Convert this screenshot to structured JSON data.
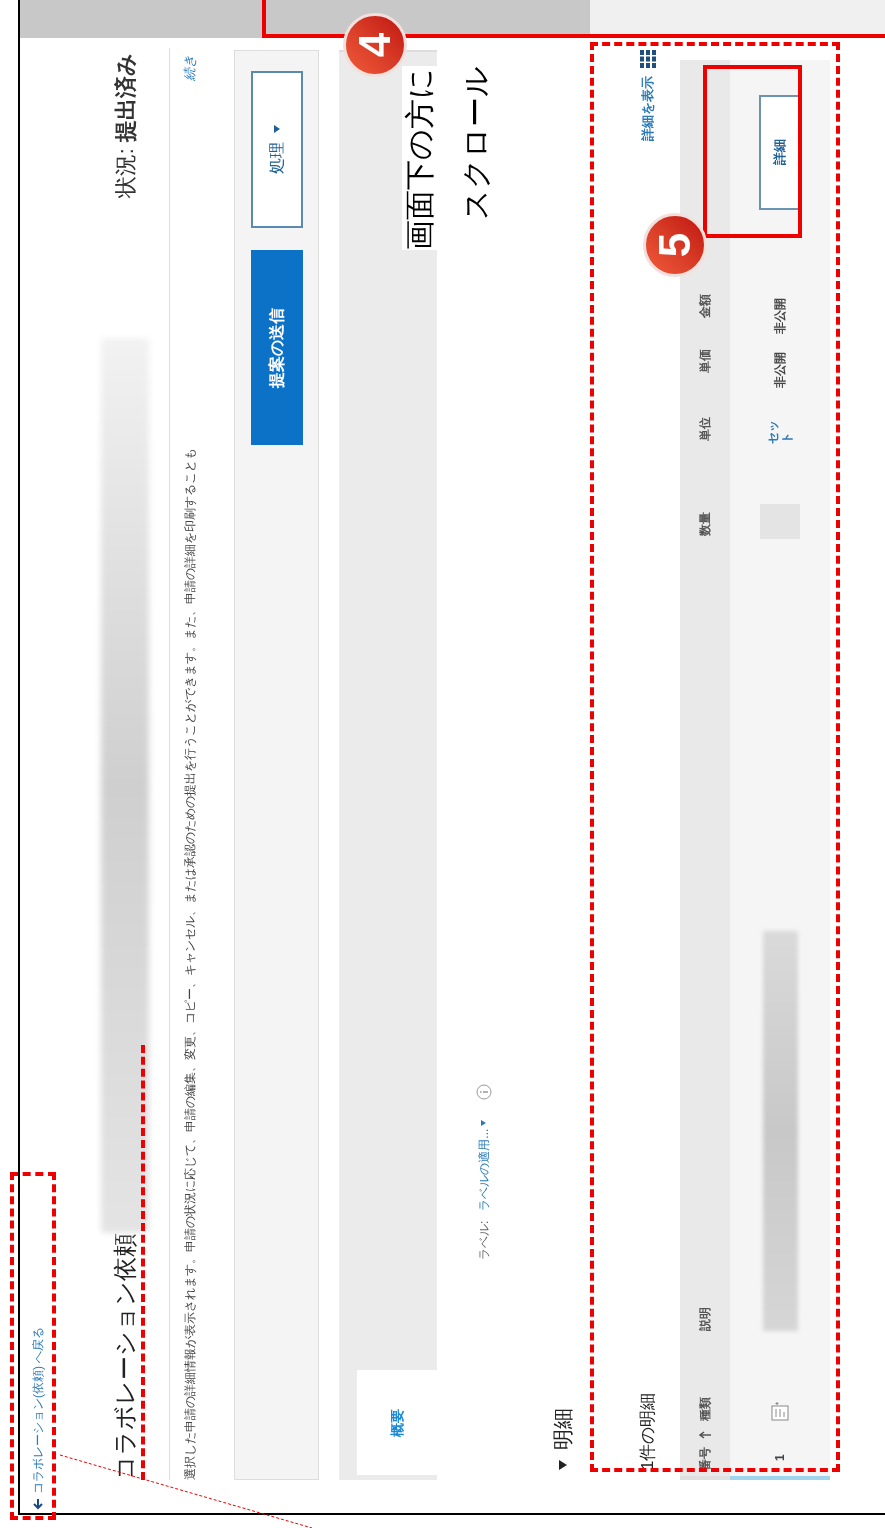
{
  "breadcrumb": {
    "text": "コラボレーション(依頼) へ戻る"
  },
  "title": "コラボレーション依頼",
  "status": {
    "label": "状況:",
    "value": "提出済み"
  },
  "description": "選択した申請の詳細情報が表示されます。申請の状況に応じて、申請の編集、変更、コピー、キャンセル、または承認のための提出を行うことができます。また、申請の詳細を印刷することも",
  "more_link": "続き",
  "toolbar": {
    "buttons": [
      {
        "label": "提案の送信",
        "kind": "primary"
      },
      {
        "label": "処理",
        "kind": "menu"
      }
    ]
  },
  "tabs": [
    {
      "label": "概要",
      "selected": true
    }
  ],
  "labels": {
    "label": "ラベル:",
    "link": "ラベルの適用..."
  },
  "section": {
    "title": "明細",
    "expanded": true
  },
  "line_items": {
    "count_text": "1件の明細",
    "show_details": "詳細を表示",
    "columns": [
      {
        "label": "番号",
        "sorted": true
      },
      {
        "label": "種類",
        "sorted": false
      },
      {
        "label": "説明",
        "sorted": false
      },
      {
        "label": "数量",
        "sorted": false
      },
      {
        "label": "単位",
        "sorted": false
      },
      {
        "label": "単価",
        "sorted": false
      },
      {
        "label": "金額",
        "sorted": false
      }
    ],
    "rows": [
      {
        "number": "1",
        "unit": "セット",
        "unit_price": "非公開",
        "amount": "非公開",
        "button": "詳細",
        "selected": true
      }
    ]
  },
  "annotations": [
    {
      "kind": "step",
      "number": "4",
      "note": [
        "画面下の方に",
        "スクロール"
      ]
    },
    {
      "kind": "step",
      "number": "5"
    }
  ]
}
